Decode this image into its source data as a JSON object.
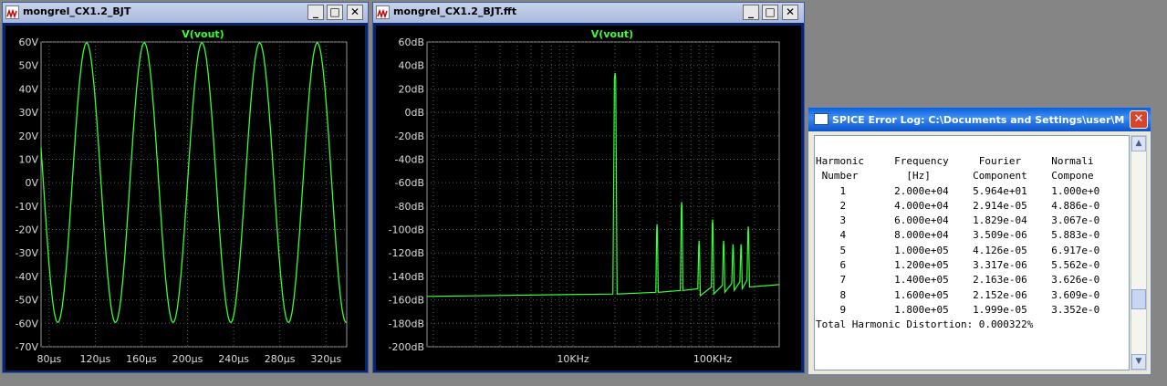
{
  "colors": {
    "trace": "#35ff35",
    "grid": "#5a5a5a",
    "plot_bg": "#000000"
  },
  "windows": {
    "transient": {
      "title": "mongrel_CX1.2_BJT",
      "buttons": {
        "minimize": "_",
        "maximize": "□",
        "close": "✕"
      },
      "trace_label": "V(vout)"
    },
    "fft": {
      "title": "mongrel_CX1.2_BJT.fft",
      "buttons": {
        "minimize": "_",
        "maximize": "□",
        "close": "✕"
      },
      "trace_label": "V(vout)"
    },
    "error_log": {
      "title": "SPICE Error Log: C:\\Documents and Settings\\user\\My Docu...",
      "close_label": "✕",
      "scroll_up": "▲",
      "scroll_down": "▼",
      "lines": [
        "Harmonic     Frequency     Fourier     Normali",
        " Number        [Hz]       Component    Compone",
        "    1        2.000e+04    5.964e+01    1.000e+0",
        "    2        4.000e+04    2.914e-05    4.886e-0",
        "    3        6.000e+04    1.829e-04    3.067e-0",
        "    4        8.000e+04    3.509e-06    5.883e-0",
        "    5        1.000e+05    4.126e-05    6.917e-0",
        "    6        1.200e+05    3.317e-06    5.562e-0",
        "    7        1.400e+05    2.163e-06    3.626e-0",
        "    8        1.600e+05    2.152e-06    3.609e-0",
        "    9        1.800e+05    1.999e-05    3.352e-0",
        "Total Harmonic Distortion: 0.000322%"
      ]
    }
  },
  "chart_data": [
    {
      "type": "line",
      "title": "V(vout)",
      "x_unit": "µs",
      "xlim": [
        73,
        338
      ],
      "ylim": [
        -70,
        60
      ],
      "x_ticks": [
        "80µs",
        "120µs",
        "160µs",
        "200µs",
        "240µs",
        "280µs",
        "320µs"
      ],
      "x_tick_values": [
        80,
        120,
        160,
        200,
        240,
        280,
        320
      ],
      "y_ticks": [
        "60V",
        "50V",
        "40V",
        "30V",
        "20V",
        "10V",
        "0V",
        "-10V",
        "-20V",
        "-30V",
        "-40V",
        "-50V",
        "-60V",
        "-70V"
      ],
      "y_tick_values": [
        60,
        50,
        40,
        30,
        20,
        10,
        0,
        -10,
        -20,
        -30,
        -40,
        -50,
        -60,
        -70
      ],
      "series": [
        {
          "name": "V(vout)",
          "kind": "sine",
          "amplitude": 59.6,
          "frequency_hz": 20000,
          "peak_at_us": 112.5
        }
      ]
    },
    {
      "type": "line",
      "title": "V(vout)",
      "x_scale": "log",
      "xlim": [
        900,
        300000
      ],
      "ylim": [
        -200,
        60
      ],
      "x_ticks": [
        "10KHz",
        "100KHz"
      ],
      "x_tick_values": [
        10000,
        100000
      ],
      "y_ticks": [
        "60dB",
        "40dB",
        "20dB",
        "0dB",
        "-20dB",
        "-40dB",
        "-60dB",
        "-80dB",
        "-100dB",
        "-120dB",
        "-140dB",
        "-160dB",
        "-180dB",
        "-200dB"
      ],
      "y_tick_values": [
        60,
        40,
        20,
        0,
        -20,
        -40,
        -60,
        -80,
        -100,
        -120,
        -140,
        -160,
        -180,
        -200
      ],
      "series": [
        {
          "name": "V(vout)",
          "noise_floor_db": -157,
          "peaks": [
            {
              "f": 20000,
              "db": 33
            },
            {
              "f": 40000,
              "db": -96
            },
            {
              "f": 60000,
              "db": -77
            },
            {
              "f": 80000,
              "db": -110
            },
            {
              "f": 100000,
              "db": -92
            },
            {
              "f": 120000,
              "db": -110
            },
            {
              "f": 140000,
              "db": -113
            },
            {
              "f": 160000,
              "db": -113
            },
            {
              "f": 180000,
              "db": -98
            }
          ]
        }
      ]
    }
  ]
}
